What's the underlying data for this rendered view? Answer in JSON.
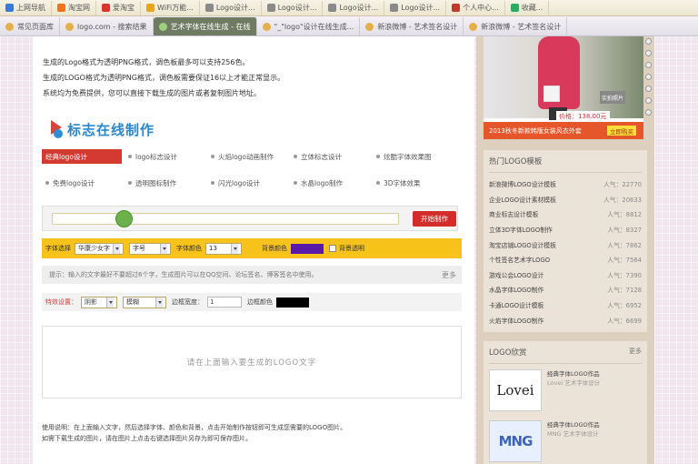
{
  "bookmarks": [
    {
      "label": "上网导航",
      "color": "#3a7bd5"
    },
    {
      "label": "淘宝网",
      "color": "#f2711c"
    },
    {
      "label": "爱淘宝",
      "color": "#d9342b"
    },
    {
      "label": "WiFi万能...",
      "color": "#e6a817"
    },
    {
      "label": "Logo设计...",
      "color": "#8a8a8a"
    },
    {
      "label": "Logo设计...",
      "color": "#8a8a8a"
    },
    {
      "label": "Logo设计...",
      "color": "#8a8a8a"
    },
    {
      "label": "Logo设计...",
      "color": "#8a8a8a"
    },
    {
      "label": "个人中心...",
      "color": "#c0392b"
    },
    {
      "label": "收藏...",
      "color": "#27ae60"
    }
  ],
  "tabs": [
    {
      "label": "常见页面库",
      "active": false
    },
    {
      "label": "logo.com - 搜索结果",
      "active": false
    },
    {
      "label": "艺术字体在线生成 - 在线",
      "active": true
    },
    {
      "label": "\"_\"logo\"设计在线生成...",
      "active": false
    },
    {
      "label": "新浪微博 - 艺术签名设计",
      "active": false
    },
    {
      "label": "新浪微博 - 艺术签名设计",
      "active": false
    }
  ],
  "intro_lines": [
    "生成的Logo格式为透明PNG格式，调色板最多可以支持256色。",
    "生成的LOGO格式为透明PNG格式，调色板需要保证16以上才能正常显示。",
    "系统均为免费提供，您可以直接下载生成的图片或者复制图片地址。"
  ],
  "site_logo": {
    "text": "标志在线制作"
  },
  "types": [
    [
      "经典logo设计",
      "logo标志设计",
      "火焰logo动画制作",
      "立体标志设计",
      "炫酷字体效果图"
    ],
    [
      "免费logo设计",
      "透明图标制作",
      "闪光logo设计",
      "水晶logo制作",
      "3D字体效果"
    ]
  ],
  "input": {
    "button": "开始制作"
  },
  "options1": {
    "font_label": "字体选择",
    "font_value": "华康少女字",
    "size_value": "字号",
    "color_label": "字体颜色",
    "color_value": "13",
    "bg_label": "背景颜色",
    "bg_color": "#5a1aa8",
    "transparent_label": "背景透明"
  },
  "notice": {
    "text": "提示：输入的文字最好不要超过6个字，生成图片可以在QQ空间、论坛签名、博客签名中使用。",
    "more": "更多"
  },
  "options3": {
    "shadow_label": "特效设置：",
    "shadow_value": "阴影",
    "shadow_type": "模糊",
    "edge_label": "边框宽度：",
    "edge_value": "1",
    "border_label": "边框颜色",
    "border_color": "#000000"
  },
  "preview": {
    "text": "请在上面输入要生成的LOGO文字"
  },
  "bottom_note": [
    "使用说明：在上面输入文字，然后选择字体、颜色和背景，点击开始制作按钮即可生成您需要的LOGO图片。",
    "如需下载生成的图片，请在图片上点击右键选择图片另存为即可保存图片。"
  ],
  "banner": {
    "price": "价格：138.00元",
    "photo_label": "实拍照片",
    "bar_text": "2013秋冬新款韩版女装风衣外套",
    "buy": "立即购买"
  },
  "hot": {
    "title": "热门LOGO模板",
    "items": [
      {
        "name": "新浪微博LOGO设计模板",
        "views": "人气：22770"
      },
      {
        "name": "企业LOGO设计素材模板",
        "views": "人气：20633"
      },
      {
        "name": "商业标志设计模板",
        "views": "人气：8812"
      },
      {
        "name": "立体3D字体LOGO制作",
        "views": "人气：8327"
      },
      {
        "name": "淘宝店铺LOGO设计模板",
        "views": "人气：7862"
      },
      {
        "name": "个性签名艺术字LOGO",
        "views": "人气：7564"
      },
      {
        "name": "游戏公会LOGO设计",
        "views": "人气：7390"
      },
      {
        "name": "水晶字体LOGO制作",
        "views": "人气：7128"
      },
      {
        "name": "卡通LOGO设计模板",
        "views": "人气：6952"
      },
      {
        "name": "火焰字体LOGO制作",
        "views": "人气：6699"
      }
    ]
  },
  "logos": {
    "title": "LOGO欣赏",
    "more": "更多",
    "items": [
      {
        "img": "Lovei",
        "title": "经典字体LOGO作品",
        "sub": "Lovei 艺术字体设计"
      },
      {
        "img": "MNG",
        "title": "经典字体LOGO作品",
        "sub": "MNG 艺术字体设计"
      }
    ]
  }
}
